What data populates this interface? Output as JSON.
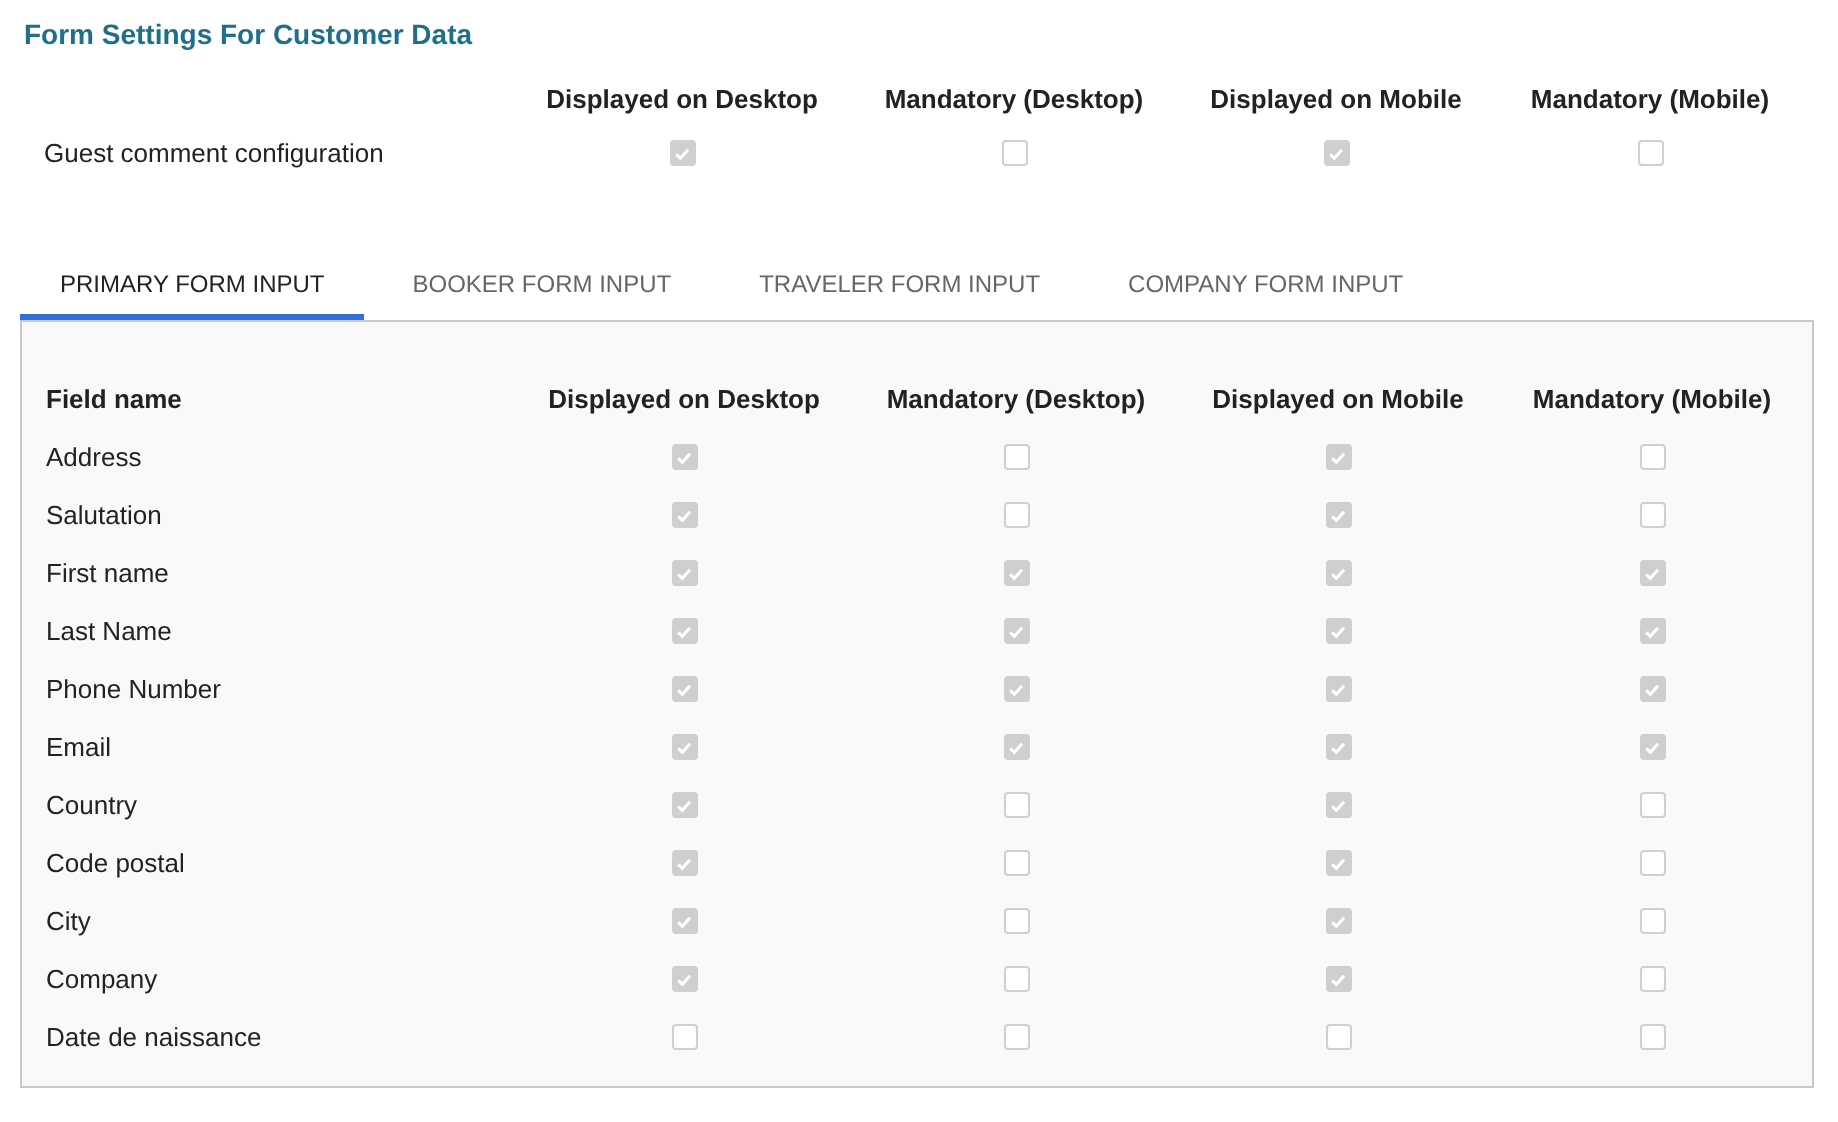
{
  "title": "Form Settings For Customer Data",
  "columns": [
    "Displayed on Desktop",
    "Mandatory (Desktop)",
    "Displayed on Mobile",
    "Mandatory (Mobile)"
  ],
  "guest_comment": {
    "label": "Guest comment configuration",
    "checks": [
      true,
      false,
      true,
      false
    ]
  },
  "tabs": [
    {
      "label": "PRIMARY FORM INPUT",
      "selected": true
    },
    {
      "label": "BOOKER FORM INPUT",
      "selected": false
    },
    {
      "label": "TRAVELER FORM INPUT",
      "selected": false
    },
    {
      "label": "COMPANY FORM INPUT",
      "selected": false
    }
  ],
  "table": {
    "header": "Field name",
    "columns": [
      "Displayed on Desktop",
      "Mandatory (Desktop)",
      "Displayed on Mobile",
      "Mandatory (Mobile)"
    ],
    "rows": [
      {
        "name": "Address",
        "checks": [
          true,
          false,
          true,
          false
        ]
      },
      {
        "name": "Salutation",
        "checks": [
          true,
          false,
          true,
          false
        ]
      },
      {
        "name": "First name",
        "checks": [
          true,
          true,
          true,
          true
        ]
      },
      {
        "name": "Last Name",
        "checks": [
          true,
          true,
          true,
          true
        ]
      },
      {
        "name": "Phone Number",
        "checks": [
          true,
          true,
          true,
          true
        ]
      },
      {
        "name": "Email",
        "checks": [
          true,
          true,
          true,
          true
        ]
      },
      {
        "name": "Country",
        "checks": [
          true,
          false,
          true,
          false
        ]
      },
      {
        "name": "Code postal",
        "checks": [
          true,
          false,
          true,
          false
        ]
      },
      {
        "name": "City",
        "checks": [
          true,
          false,
          true,
          false
        ]
      },
      {
        "name": "Company",
        "checks": [
          true,
          false,
          true,
          false
        ]
      },
      {
        "name": "Date de naissance",
        "checks": [
          false,
          false,
          false,
          false
        ]
      }
    ]
  }
}
